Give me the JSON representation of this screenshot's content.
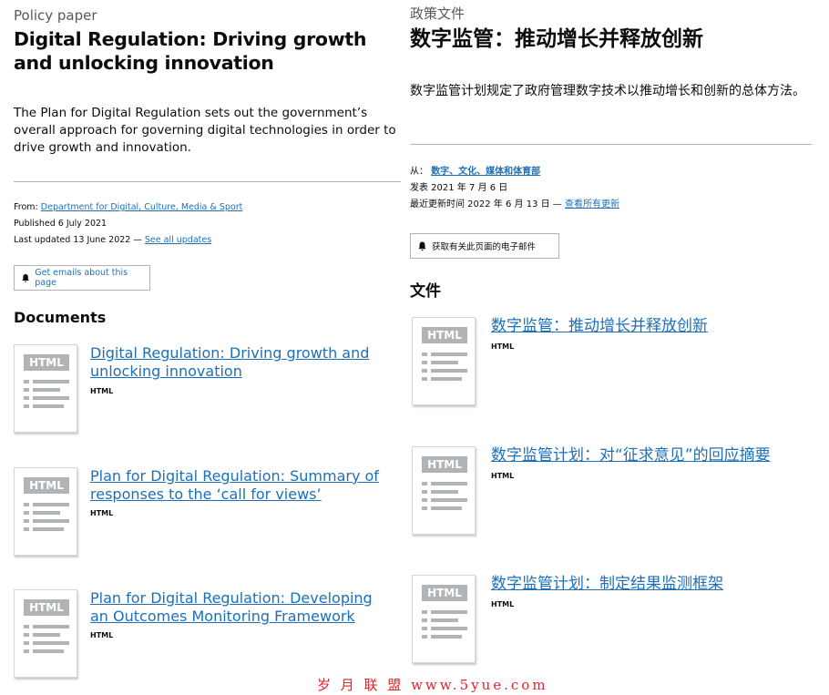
{
  "en": {
    "caption": "Policy paper",
    "title": "Digital Regulation: Driving growth and unlocking innovation",
    "summary": "The Plan for Digital Regulation sets out the government’s overall approach for governing digital technologies in order to drive growth and innovation.",
    "meta": {
      "from_label": "From:",
      "from_link": "Department for Digital, Culture, Media & Sport",
      "published": "Published 6 July 2021",
      "updated_prefix": "Last updated 13 June 2022 —",
      "updated_link": "See all updates"
    },
    "email_button": "Get emails about this page",
    "documents_heading": "Documents",
    "documents": [
      {
        "title": "Digital Regulation: Driving growth and unlocking innovation",
        "type": "HTML"
      },
      {
        "title": "Plan for Digital Regulation: Summary of responses to the ‘call for views’",
        "type": "HTML"
      },
      {
        "title": "Plan for Digital Regulation: Developing an Outcomes Monitoring Framework",
        "type": "HTML"
      }
    ]
  },
  "zh": {
    "caption": "政策文件",
    "title": "数字监管：推动增长并释放创新",
    "summary": "数字监管计划规定了政府管理数字技术以推动增长和创新的总体方法。",
    "meta": {
      "from_label": "从：",
      "from_link": "数字、文化、媒体和体育部",
      "published": "发表 2021 年 7 月 6 日",
      "updated_prefix": "最近更新时间 2022 年 6 月 13 日 —",
      "updated_link": "查看所有更新"
    },
    "email_button": "获取有关此页面的电子邮件",
    "documents_heading": "文件",
    "documents": [
      {
        "title": "数字监管：推动增长并释放创新",
        "type": "HTML"
      },
      {
        "title": "数字监管计划：对“征求意见”的回应摘要",
        "type": "HTML"
      },
      {
        "title": "数字监管计划：制定结果监测框架",
        "type": "HTML"
      }
    ]
  },
  "thumb_label": "HTML",
  "watermark": "岁 月 联 盟  www.5yue.com"
}
